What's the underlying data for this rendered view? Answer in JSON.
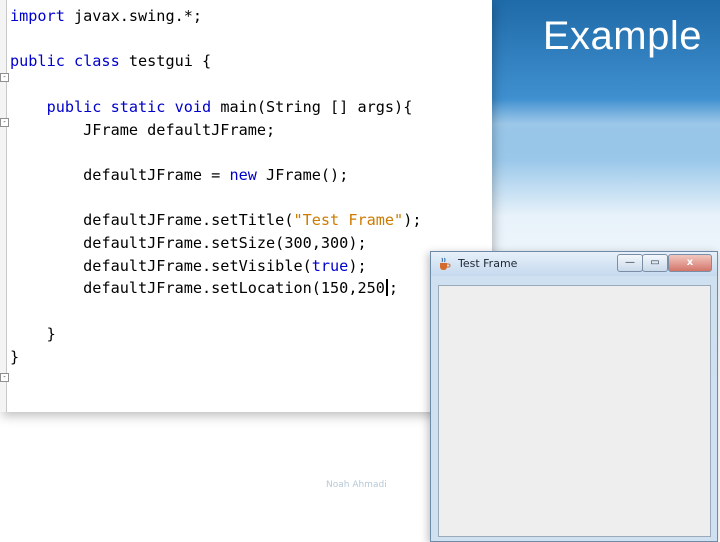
{
  "slide": {
    "title": "Example",
    "footer": "Noah Ahmadi"
  },
  "editor": {
    "lines": {
      "l1": {
        "kw": "import",
        "rest": " javax.swing.*;"
      },
      "l2": {
        "kw": "public class",
        "rest": " testgui {"
      },
      "l3": {
        "kw": "public static void",
        "rest": " main(String [] args){"
      },
      "l4": "JFrame defaultJFrame;",
      "l5": {
        "a": "defaultJFrame = ",
        "kw": "new",
        "b": " JFrame();"
      },
      "l6": {
        "a": "defaultJFrame.setTitle(",
        "str": "\"Test Frame\"",
        "b": ");"
      },
      "l7": "defaultJFrame.setSize(300,300);",
      "l8": {
        "a": "defaultJFrame.setVisible(",
        "kw": "true",
        "b": ");"
      },
      "l9": {
        "a": "defaultJFrame.setLocation(150,250",
        "b": ";"
      },
      "l10": "}",
      "l11": "}"
    },
    "fold_markers": [
      "-",
      "-",
      "-"
    ]
  },
  "window": {
    "title": "Test Frame",
    "minimize_symbol": "—",
    "maximize_symbol": "▭",
    "close_symbol": "x"
  },
  "colors": {
    "keyword": "#0000cc",
    "string": "#ce7b00",
    "slide_blue": "#1f6aa8"
  }
}
